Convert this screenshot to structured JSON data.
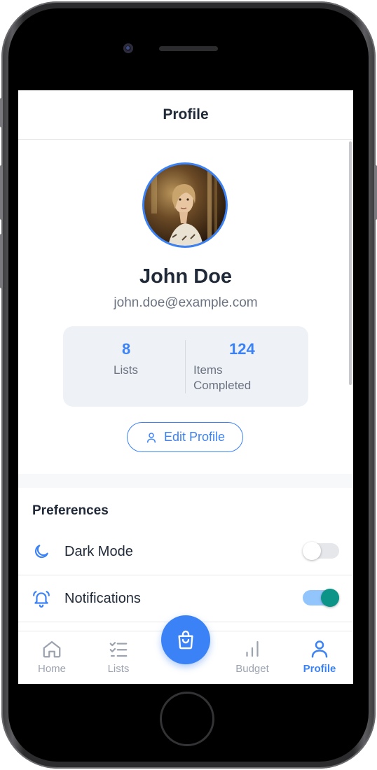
{
  "header": {
    "title": "Profile"
  },
  "profile": {
    "name": "John Doe",
    "email": "john.doe@example.com"
  },
  "stats": {
    "lists": {
      "value": "8",
      "label": "Lists"
    },
    "items_completed": {
      "value": "124",
      "label_line1": "Items",
      "label_line2": "Completed"
    }
  },
  "actions": {
    "edit_profile_label": "Edit Profile"
  },
  "preferences": {
    "title": "Preferences",
    "items": [
      {
        "label": "Dark Mode",
        "icon": "moon-icon",
        "enabled": false
      },
      {
        "label": "Notifications",
        "icon": "bell-icon",
        "enabled": true
      }
    ]
  },
  "nav": {
    "items": [
      {
        "label": "Home",
        "icon": "home-icon",
        "active": false
      },
      {
        "label": "Lists",
        "icon": "checklist-icon",
        "active": false
      },
      {
        "label": "Budget",
        "icon": "bar-chart-icon",
        "active": false
      },
      {
        "label": "Profile",
        "icon": "user-icon",
        "active": true
      }
    ],
    "fab_icon": "shopping-bag-icon"
  },
  "colors": {
    "accent": "#3b82f6",
    "toggle_on_knob": "#0d9488",
    "toggle_on_track": "#93c5fd",
    "toggle_off_track": "#e5e7eb"
  }
}
